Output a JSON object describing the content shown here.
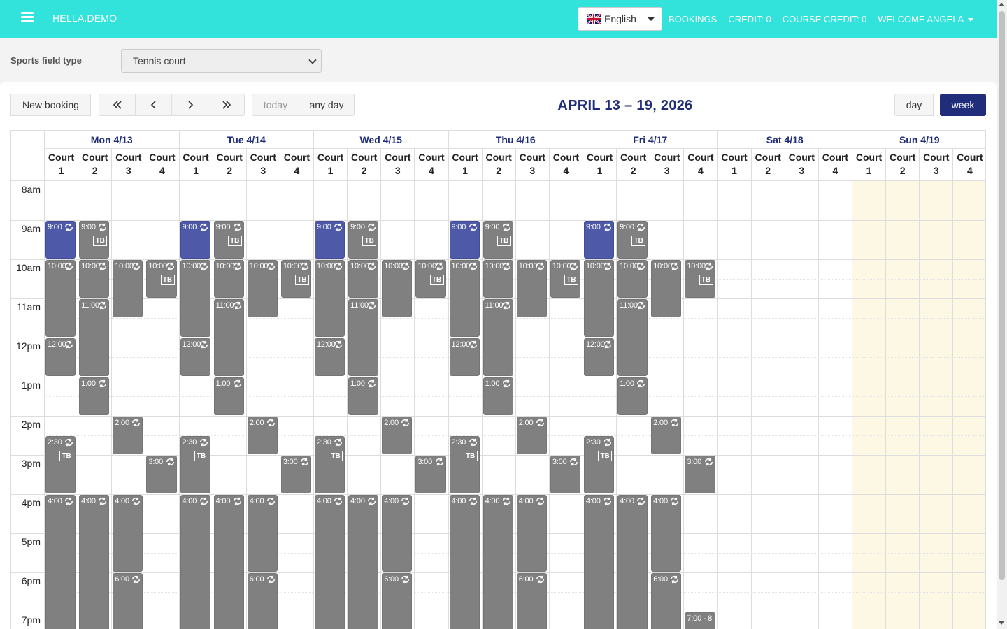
{
  "navbar": {
    "brand": "HELLA.DEMO",
    "language": "English",
    "links": {
      "bookings": "BOOKINGS",
      "credit": "CREDIT: 0",
      "course_credit": "COURSE CREDIT: 0",
      "welcome": "WELCOME ANGELA"
    },
    "color": "#31e3db"
  },
  "filter": {
    "label": "Sports field type",
    "selected": "Tennis court"
  },
  "toolbar": {
    "new_booking": "New booking",
    "today": "today",
    "any_day": "any day",
    "day": "day",
    "week": "week",
    "title": "APRIL 13 – 19, 2026"
  },
  "calendar": {
    "days": [
      "Mon 4/13",
      "Tue 4/14",
      "Wed 4/15",
      "Thu 4/16",
      "Fri 4/17",
      "Sat 4/18",
      "Sun 4/19"
    ],
    "court_word": "Court",
    "courts": [
      "1",
      "2",
      "3",
      "4"
    ],
    "times": [
      "8am",
      "9am",
      "10am",
      "11am",
      "12pm",
      "1pm",
      "2pm",
      "3pm",
      "4pm",
      "5pm",
      "6pm",
      "7pm"
    ],
    "highlight_day": 6,
    "accent": "#1f2d7b",
    "booked_color": "#808080",
    "own_color": "#4e5aa8",
    "events": [
      {
        "day": 0,
        "court": 0,
        "start": 9,
        "end": 10,
        "label": "9:00",
        "style": "blue",
        "tb": false
      },
      {
        "day": 0,
        "court": 1,
        "start": 9,
        "end": 10,
        "label": "9:00",
        "tb": true
      },
      {
        "day": 0,
        "court": 0,
        "start": 10,
        "end": 12,
        "label": "10:00",
        "tb": false
      },
      {
        "day": 0,
        "court": 1,
        "start": 10,
        "end": 11,
        "label": "10:00",
        "tb": false
      },
      {
        "day": 0,
        "court": 2,
        "start": 10,
        "end": 11.5,
        "label": "10:00",
        "tb": false
      },
      {
        "day": 0,
        "court": 3,
        "start": 10,
        "end": 11,
        "label": "10:00",
        "tb": true
      },
      {
        "day": 0,
        "court": 1,
        "start": 11,
        "end": 13,
        "label": "11:00",
        "tb": false
      },
      {
        "day": 0,
        "court": 0,
        "start": 12,
        "end": 13,
        "label": "12:00",
        "tb": false
      },
      {
        "day": 0,
        "court": 1,
        "start": 13,
        "end": 14,
        "label": "1:00",
        "tb": false
      },
      {
        "day": 0,
        "court": 2,
        "start": 14,
        "end": 15,
        "label": "2:00",
        "tb": false
      },
      {
        "day": 0,
        "court": 0,
        "start": 14.5,
        "end": 16,
        "label": "2:30",
        "tb": true
      },
      {
        "day": 0,
        "court": 3,
        "start": 15,
        "end": 16,
        "label": "3:00",
        "tb": false
      },
      {
        "day": 0,
        "court": 0,
        "start": 16,
        "end": 20,
        "label": "4:00",
        "tb": false
      },
      {
        "day": 0,
        "court": 1,
        "start": 16,
        "end": 20,
        "label": "4:00",
        "tb": false
      },
      {
        "day": 0,
        "court": 2,
        "start": 16,
        "end": 18,
        "label": "4:00",
        "tb": false
      },
      {
        "day": 0,
        "court": 2,
        "start": 18,
        "end": 20,
        "label": "6:00",
        "tb": false
      },
      {
        "day": 1,
        "court": 0,
        "start": 9,
        "end": 10,
        "label": "9:00",
        "style": "blue",
        "tb": false
      },
      {
        "day": 1,
        "court": 1,
        "start": 9,
        "end": 10,
        "label": "9:00",
        "tb": true
      },
      {
        "day": 1,
        "court": 0,
        "start": 10,
        "end": 12,
        "label": "10:00",
        "tb": false
      },
      {
        "day": 1,
        "court": 1,
        "start": 10,
        "end": 11,
        "label": "10:00",
        "tb": false
      },
      {
        "day": 1,
        "court": 2,
        "start": 10,
        "end": 11.5,
        "label": "10:00",
        "tb": false
      },
      {
        "day": 1,
        "court": 3,
        "start": 10,
        "end": 11,
        "label": "10:00",
        "tb": true
      },
      {
        "day": 1,
        "court": 1,
        "start": 11,
        "end": 13,
        "label": "11:00",
        "tb": false
      },
      {
        "day": 1,
        "court": 0,
        "start": 12,
        "end": 13,
        "label": "12:00",
        "tb": false
      },
      {
        "day": 1,
        "court": 1,
        "start": 13,
        "end": 14,
        "label": "1:00",
        "tb": false
      },
      {
        "day": 1,
        "court": 2,
        "start": 14,
        "end": 15,
        "label": "2:00",
        "tb": false
      },
      {
        "day": 1,
        "court": 0,
        "start": 14.5,
        "end": 16,
        "label": "2:30",
        "tb": true
      },
      {
        "day": 1,
        "court": 3,
        "start": 15,
        "end": 16,
        "label": "3:00",
        "tb": false
      },
      {
        "day": 1,
        "court": 0,
        "start": 16,
        "end": 20,
        "label": "4:00",
        "tb": false
      },
      {
        "day": 1,
        "court": 1,
        "start": 16,
        "end": 20,
        "label": "4:00",
        "tb": false
      },
      {
        "day": 1,
        "court": 2,
        "start": 16,
        "end": 18,
        "label": "4:00",
        "tb": false
      },
      {
        "day": 1,
        "court": 2,
        "start": 18,
        "end": 20,
        "label": "6:00",
        "tb": false
      },
      {
        "day": 2,
        "court": 0,
        "start": 9,
        "end": 10,
        "label": "9:00",
        "style": "blue",
        "tb": false
      },
      {
        "day": 2,
        "court": 1,
        "start": 9,
        "end": 10,
        "label": "9:00",
        "tb": true
      },
      {
        "day": 2,
        "court": 0,
        "start": 10,
        "end": 12,
        "label": "10:00",
        "tb": false
      },
      {
        "day": 2,
        "court": 1,
        "start": 10,
        "end": 11,
        "label": "10:00",
        "tb": false
      },
      {
        "day": 2,
        "court": 2,
        "start": 10,
        "end": 11.5,
        "label": "10:00",
        "tb": false
      },
      {
        "day": 2,
        "court": 3,
        "start": 10,
        "end": 11,
        "label": "10:00",
        "tb": true
      },
      {
        "day": 2,
        "court": 1,
        "start": 11,
        "end": 13,
        "label": "11:00",
        "tb": false
      },
      {
        "day": 2,
        "court": 0,
        "start": 12,
        "end": 13,
        "label": "12:00",
        "tb": false
      },
      {
        "day": 2,
        "court": 1,
        "start": 13,
        "end": 14,
        "label": "1:00",
        "tb": false
      },
      {
        "day": 2,
        "court": 2,
        "start": 14,
        "end": 15,
        "label": "2:00",
        "tb": false
      },
      {
        "day": 2,
        "court": 0,
        "start": 14.5,
        "end": 16,
        "label": "2:30",
        "tb": true
      },
      {
        "day": 2,
        "court": 3,
        "start": 15,
        "end": 16,
        "label": "3:00",
        "tb": false
      },
      {
        "day": 2,
        "court": 0,
        "start": 16,
        "end": 20,
        "label": "4:00",
        "tb": false
      },
      {
        "day": 2,
        "court": 1,
        "start": 16,
        "end": 20,
        "label": "4:00",
        "tb": false
      },
      {
        "day": 2,
        "court": 2,
        "start": 16,
        "end": 18,
        "label": "4:00",
        "tb": false
      },
      {
        "day": 2,
        "court": 2,
        "start": 18,
        "end": 20,
        "label": "6:00",
        "tb": false
      },
      {
        "day": 3,
        "court": 0,
        "start": 9,
        "end": 10,
        "label": "9:00",
        "style": "blue",
        "tb": false
      },
      {
        "day": 3,
        "court": 1,
        "start": 9,
        "end": 10,
        "label": "9:00",
        "tb": true
      },
      {
        "day": 3,
        "court": 0,
        "start": 10,
        "end": 12,
        "label": "10:00",
        "tb": false
      },
      {
        "day": 3,
        "court": 1,
        "start": 10,
        "end": 11,
        "label": "10:00",
        "tb": false
      },
      {
        "day": 3,
        "court": 2,
        "start": 10,
        "end": 11.5,
        "label": "10:00",
        "tb": false
      },
      {
        "day": 3,
        "court": 3,
        "start": 10,
        "end": 11,
        "label": "10:00",
        "tb": true
      },
      {
        "day": 3,
        "court": 1,
        "start": 11,
        "end": 13,
        "label": "11:00",
        "tb": false
      },
      {
        "day": 3,
        "court": 0,
        "start": 12,
        "end": 13,
        "label": "12:00",
        "tb": false
      },
      {
        "day": 3,
        "court": 1,
        "start": 13,
        "end": 14,
        "label": "1:00",
        "tb": false
      },
      {
        "day": 3,
        "court": 2,
        "start": 14,
        "end": 15,
        "label": "2:00",
        "tb": false
      },
      {
        "day": 3,
        "court": 0,
        "start": 14.5,
        "end": 16,
        "label": "2:30",
        "tb": true
      },
      {
        "day": 3,
        "court": 3,
        "start": 15,
        "end": 16,
        "label": "3:00",
        "tb": false
      },
      {
        "day": 3,
        "court": 0,
        "start": 16,
        "end": 20,
        "label": "4:00",
        "tb": false
      },
      {
        "day": 3,
        "court": 1,
        "start": 16,
        "end": 20,
        "label": "4:00",
        "tb": false
      },
      {
        "day": 3,
        "court": 2,
        "start": 16,
        "end": 18,
        "label": "4:00",
        "tb": false
      },
      {
        "day": 3,
        "court": 2,
        "start": 18,
        "end": 20,
        "label": "6:00",
        "tb": false
      },
      {
        "day": 4,
        "court": 0,
        "start": 9,
        "end": 10,
        "label": "9:00",
        "style": "blue",
        "tb": false
      },
      {
        "day": 4,
        "court": 1,
        "start": 9,
        "end": 10,
        "label": "9:00",
        "tb": true
      },
      {
        "day": 4,
        "court": 0,
        "start": 10,
        "end": 12,
        "label": "10:00",
        "tb": false
      },
      {
        "day": 4,
        "court": 1,
        "start": 10,
        "end": 11,
        "label": "10:00",
        "tb": false
      },
      {
        "day": 4,
        "court": 2,
        "start": 10,
        "end": 11.5,
        "label": "10:00",
        "tb": false
      },
      {
        "day": 4,
        "court": 3,
        "start": 10,
        "end": 11,
        "label": "10:00",
        "tb": true
      },
      {
        "day": 4,
        "court": 1,
        "start": 11,
        "end": 13,
        "label": "11:00",
        "tb": false
      },
      {
        "day": 4,
        "court": 0,
        "start": 12,
        "end": 13,
        "label": "12:00",
        "tb": false
      },
      {
        "day": 4,
        "court": 1,
        "start": 13,
        "end": 14,
        "label": "1:00",
        "tb": false
      },
      {
        "day": 4,
        "court": 2,
        "start": 14,
        "end": 15,
        "label": "2:00",
        "tb": false
      },
      {
        "day": 4,
        "court": 0,
        "start": 14.5,
        "end": 16,
        "label": "2:30",
        "tb": true
      },
      {
        "day": 4,
        "court": 3,
        "start": 15,
        "end": 16,
        "label": "3:00",
        "tb": false
      },
      {
        "day": 4,
        "court": 0,
        "start": 16,
        "end": 20,
        "label": "4:00",
        "tb": false
      },
      {
        "day": 4,
        "court": 1,
        "start": 16,
        "end": 20,
        "label": "4:00",
        "tb": false
      },
      {
        "day": 4,
        "court": 2,
        "start": 16,
        "end": 18,
        "label": "4:00",
        "tb": false
      },
      {
        "day": 4,
        "court": 2,
        "start": 18,
        "end": 20,
        "label": "6:00",
        "tb": false
      },
      {
        "day": 4,
        "court": 3,
        "start": 19,
        "end": 20,
        "label": "7:00 - 8",
        "tb": false,
        "noicon": true
      }
    ]
  }
}
